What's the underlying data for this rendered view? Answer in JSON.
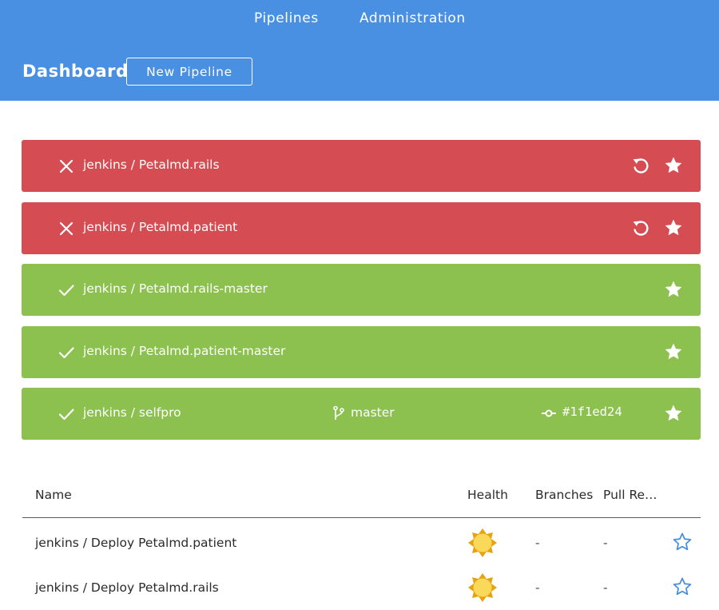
{
  "header": {
    "nav": [
      {
        "label": "Pipelines"
      },
      {
        "label": "Administration"
      }
    ],
    "title": "Dashboard",
    "new_pipeline_label": "New Pipeline",
    "background_color": "#4a90e2"
  },
  "favorites": [
    {
      "status": "failure",
      "name": "jenkins / Petalmd.rails",
      "actions": [
        "replay-icon",
        "star-icon"
      ]
    },
    {
      "status": "failure",
      "name": "jenkins / Petalmd.patient",
      "actions": [
        "replay-icon",
        "star-icon"
      ]
    },
    {
      "status": "success",
      "name": "jenkins / Petalmd.rails-master",
      "actions": [
        "star-icon"
      ]
    },
    {
      "status": "success",
      "name": "jenkins / Petalmd.patient-master",
      "actions": [
        "star-icon"
      ]
    },
    {
      "status": "success",
      "name": "jenkins / selfpro",
      "branch": "master",
      "commit": "#1f1ed24",
      "actions": [
        "star-icon"
      ]
    }
  ],
  "status_colors": {
    "failure": "#d54c53",
    "success": "#8cc04f"
  },
  "table": {
    "columns": {
      "name": "Name",
      "health": "Health",
      "branches": "Branches",
      "pull_requests": "Pull Re…"
    },
    "rows": [
      {
        "name": "jenkins / Deploy Petalmd.patient",
        "health": "sunny-icon",
        "branches": "-",
        "pull_requests": "-",
        "favorite": false
      },
      {
        "name": "jenkins / Deploy Petalmd.rails",
        "health": "sunny-icon",
        "branches": "-",
        "pull_requests": "-",
        "favorite": false
      }
    ],
    "star_color": "#4a90e2"
  }
}
